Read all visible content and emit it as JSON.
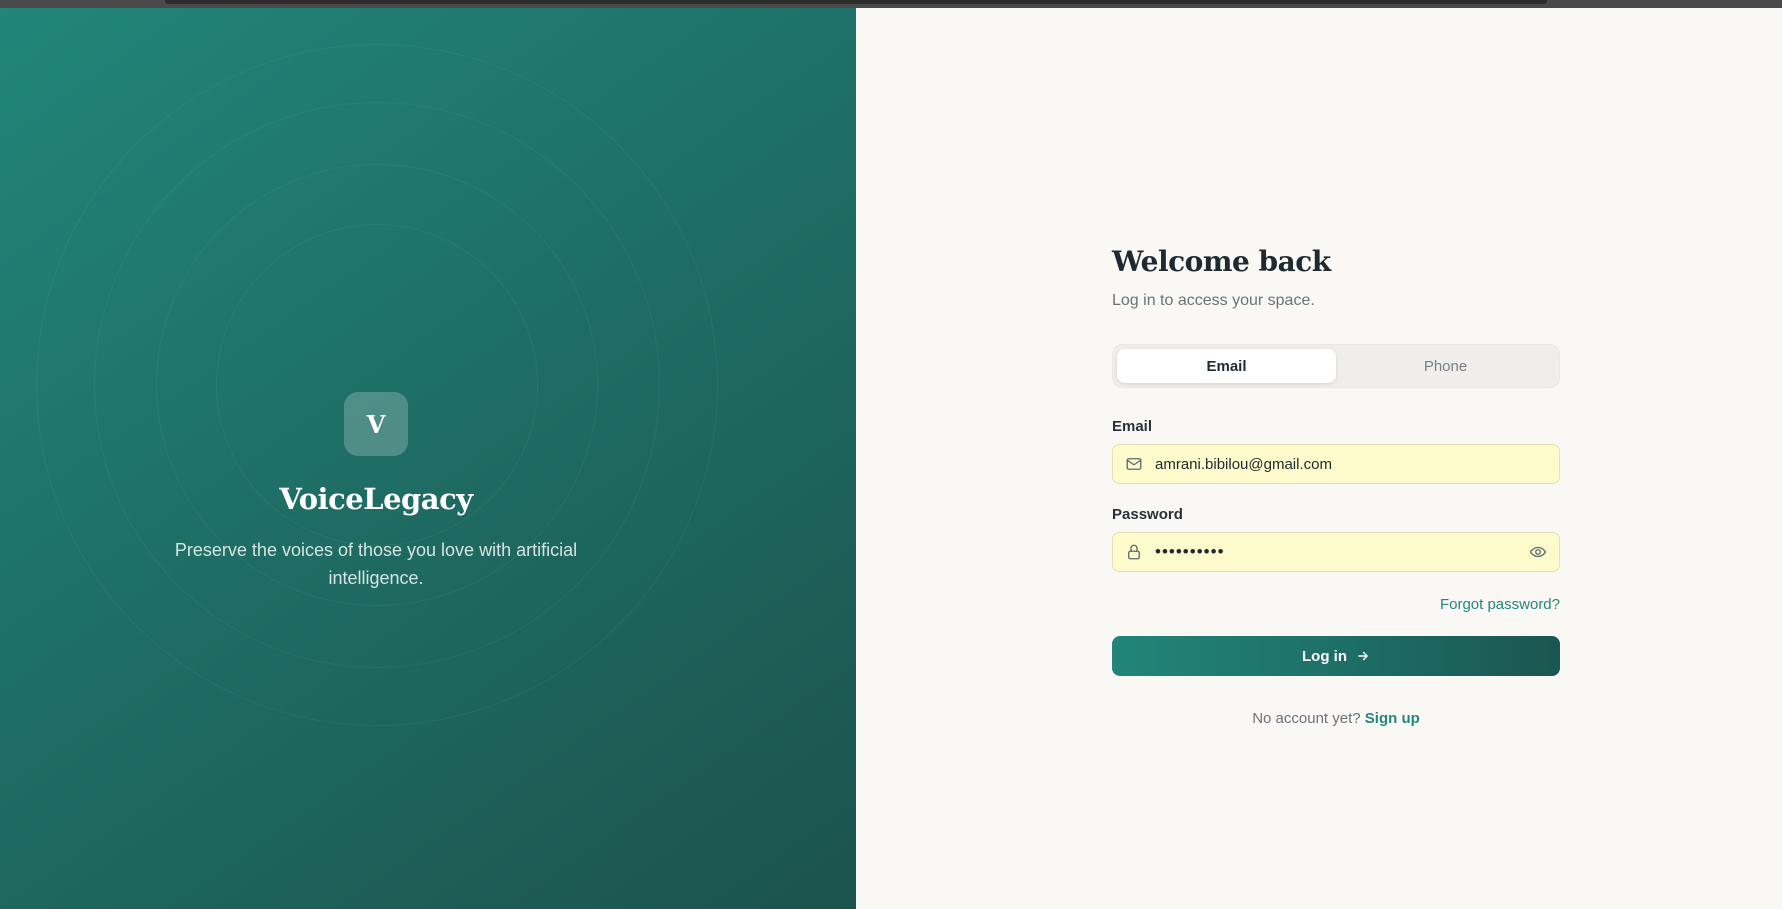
{
  "brand": {
    "logo_letter": "V",
    "name": "VoiceLegacy",
    "tagline": "Preserve the voices of those you love with artificial intelligence."
  },
  "login": {
    "title": "Welcome back",
    "subtitle": "Log in to access your space.",
    "tabs": [
      {
        "label": "Email",
        "active": true
      },
      {
        "label": "Phone",
        "active": false
      }
    ],
    "email_label": "Email",
    "email_value": "amrani.bibilou@gmail.com",
    "password_label": "Password",
    "password_value": "••••••••••",
    "forgot_label": "Forgot password?",
    "submit_label": "Log in",
    "no_account_text": "No account yet?",
    "signup_label": "Sign up"
  },
  "icons": {
    "email": "mail-icon",
    "password": "lock-icon",
    "toggle": "eye-icon",
    "submit": "arrow-right-icon"
  },
  "colors": {
    "brand_teal": "#22877c",
    "brand_teal_dark": "#1c534d",
    "autofill_bg": "#fdfbcc",
    "page_bg": "#faf8f4",
    "text_dark": "#1f2a30"
  }
}
